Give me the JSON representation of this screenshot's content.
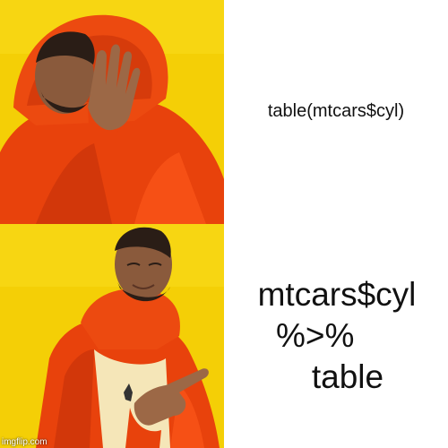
{
  "panels": {
    "top": {
      "caption": "table(mtcars$cyl)",
      "person": "disapproving man in orange puffer jacket holding up hand",
      "background_color": "#f6d200"
    },
    "bottom": {
      "caption_lines": [
        "mtcars$cyl",
        "%>%",
        "table"
      ],
      "person": "approving man in orange puffer jacket pointing",
      "background_color": "#f6d200"
    }
  },
  "watermark": "imgflip.com",
  "colors": {
    "yellow": "#f6d200",
    "jacket": "#e8420c",
    "text": "#111111"
  }
}
